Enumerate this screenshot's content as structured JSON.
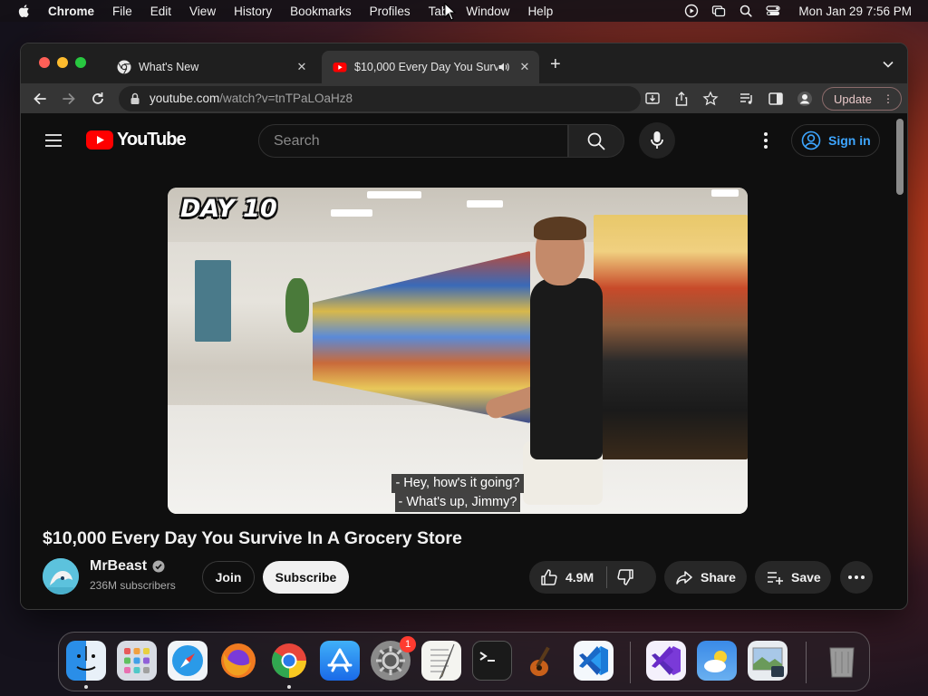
{
  "menubar": {
    "app_name": "Chrome",
    "items": [
      "File",
      "Edit",
      "View",
      "History",
      "Bookmarks",
      "Profiles",
      "Tab",
      "Window",
      "Help"
    ],
    "clock": "Mon Jan 29  7:56 PM",
    "status_icons": [
      "play-circle-icon",
      "screen-mirror-icon",
      "spotlight-search-icon",
      "control-center-icon"
    ]
  },
  "tabs": [
    {
      "title": "What's New",
      "favicon": "chrome-icon",
      "active": false
    },
    {
      "title": "$10,000 Every Day You Survive In A Grocery Store",
      "favicon": "youtube-icon",
      "active": true,
      "audio": true
    }
  ],
  "toolbar": {
    "url_domain": "youtube.com",
    "url_path": "/watch?v=tnTPaLOaHz8",
    "update_label": "Update"
  },
  "youtube": {
    "logo_text": "YouTube",
    "search_placeholder": "Search",
    "sign_in_label": "Sign in",
    "video": {
      "overlay_text": "DAY 10",
      "caption_line1": "- Hey, how's it going?",
      "caption_line2": "- What's up, Jimmy?"
    },
    "video_title": "$10,000 Every Day You Survive In A Grocery Store",
    "channel": {
      "name": "MrBeast",
      "subscribers": "236M subscribers",
      "verified": true
    },
    "actions": {
      "join_label": "Join",
      "subscribe_label": "Subscribe",
      "likes": "4.9M",
      "share_label": "Share",
      "save_label": "Save"
    }
  },
  "dock": {
    "apps": [
      "Finder",
      "Launchpad",
      "Safari",
      "Firefox",
      "Chrome",
      "App Store",
      "System Settings",
      "TextEdit",
      "Terminal",
      "GarageBand",
      "VS Code",
      "Visual Studio",
      "Weather",
      "Preview",
      "Trash"
    ],
    "settings_badge": "1"
  },
  "colors": {
    "youtube_red": "#ff0000",
    "sign_in_blue": "#3ea6ff",
    "page_bg": "#0f0f0f"
  }
}
